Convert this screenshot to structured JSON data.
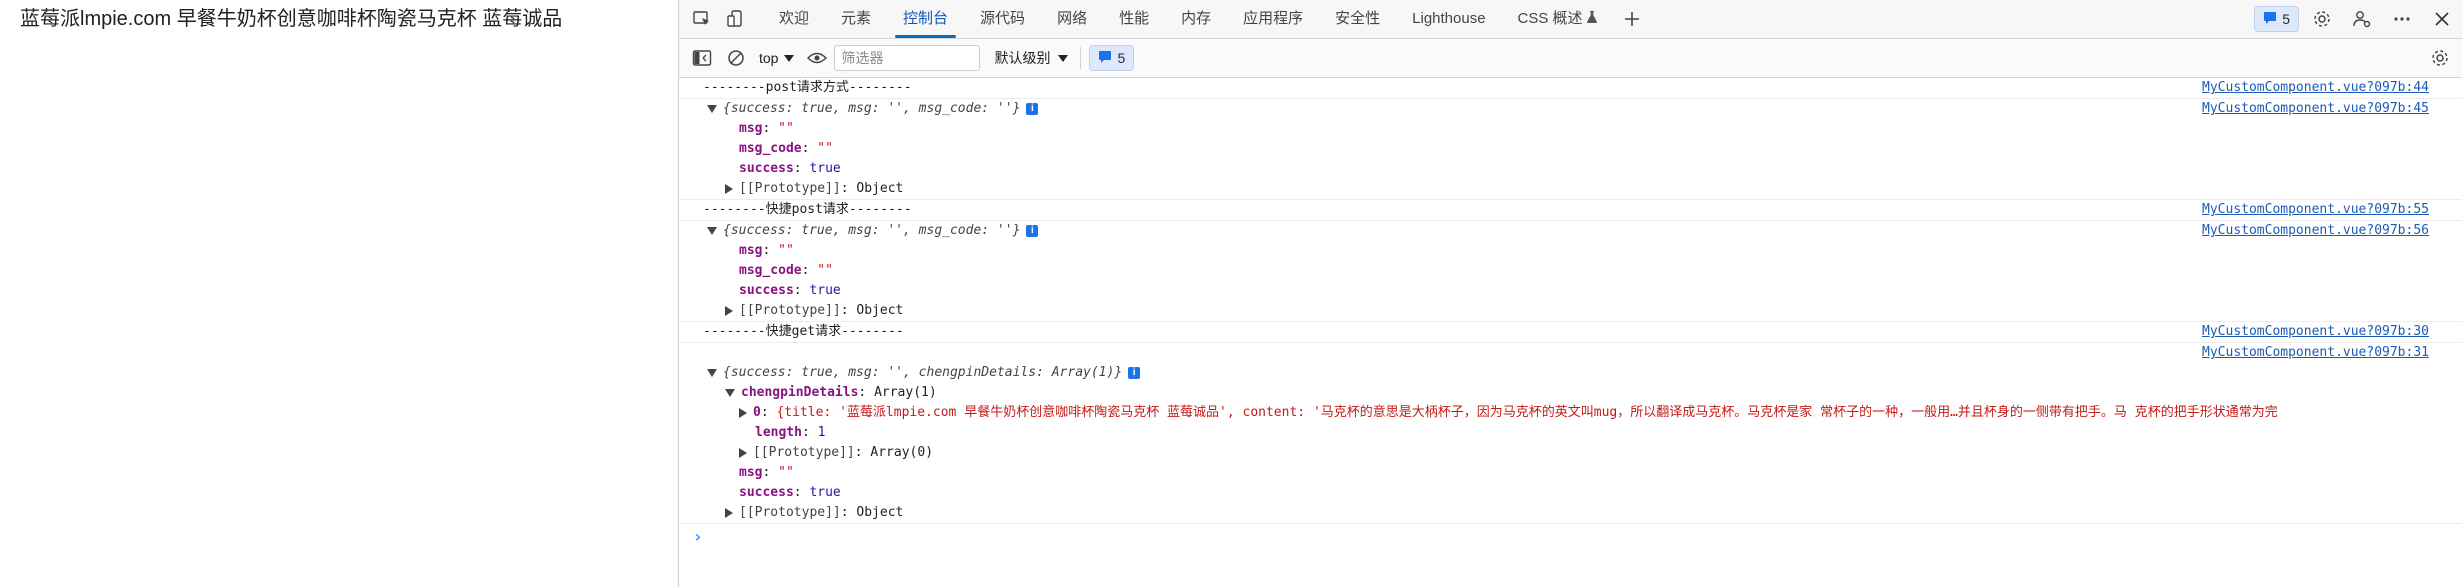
{
  "page": {
    "title": "蓝莓派lmpie.com 早餐牛奶杯创意咖啡杯陶瓷马克杯 蓝莓诚品"
  },
  "devtools": {
    "tabs": [
      {
        "label": "欢迎"
      },
      {
        "label": "元素"
      },
      {
        "label": "控制台"
      },
      {
        "label": "源代码"
      },
      {
        "label": "网络"
      },
      {
        "label": "性能"
      },
      {
        "label": "内存"
      },
      {
        "label": "应用程序"
      },
      {
        "label": "安全性"
      },
      {
        "label": "Lighthouse"
      },
      {
        "label": "CSS 概述"
      }
    ],
    "active_tab": "控制台",
    "issues_count": "5",
    "toolbar": {
      "context": "top",
      "filter_placeholder": "筛选器",
      "levels": "默认级别",
      "issues_count": "5"
    },
    "colors": {
      "accent": "#0f6cbd",
      "link": "#1a5bb8",
      "key": "#881280",
      "string": "#c41a16",
      "boolean": "#1a1aa6"
    }
  },
  "console": {
    "l1": {
      "text": "--------post请求方式--------",
      "src": "MyCustomComponent.vue?097b:44"
    },
    "l2": {
      "obj": "{success: true, msg: '', msg_code: ''}",
      "src": "MyCustomComponent.vue?097b:45"
    },
    "l3": {
      "key": "msg",
      "val": "\"\""
    },
    "l4": {
      "key": "msg_code",
      "val": "\"\""
    },
    "l5": {
      "key": "success",
      "val": "true"
    },
    "l6": {
      "key": "[[Prototype]]",
      "val": "Object"
    },
    "l7": {
      "text": "--------快捷post请求--------",
      "src": "MyCustomComponent.vue?097b:55"
    },
    "l8": {
      "obj": "{success: true, msg: '', msg_code: ''}",
      "src": "MyCustomComponent.vue?097b:56"
    },
    "l9": {
      "key": "msg",
      "val": "\"\""
    },
    "l10": {
      "key": "msg_code",
      "val": "\"\""
    },
    "l11": {
      "key": "success",
      "val": "true"
    },
    "l12": {
      "key": "[[Prototype]]",
      "val": "Object"
    },
    "l13": {
      "text": "--------快捷get请求--------",
      "src": "MyCustomComponent.vue?097b:30"
    },
    "l14": {
      "src": "MyCustomComponent.vue?097b:31"
    },
    "l15": {
      "obj": "{success: true, msg: '', chengpinDetails: Array(1)}"
    },
    "l16": {
      "key": "chengpinDetails",
      "val": "Array(1)"
    },
    "l17": {
      "key": "0",
      "val": "{title: '蓝莓派lmpie.com 早餐牛奶杯创意咖啡杯陶瓷马克杯 蓝莓诚品', content: '马克杯的意思是大柄杯子，因为马克杯的英文叫mug，所以翻译成马克杯。马克杯是家 常杯子的一种，一般用…并且杯身的一侧带有把手。马 克杯的把手形状通常为完"
    },
    "l18": {
      "key": "length",
      "val": "1"
    },
    "l19": {
      "key": "[[Prototype]]",
      "val": "Array(0)"
    },
    "l20": {
      "key": "msg",
      "val": "\"\""
    },
    "l21": {
      "key": "success",
      "val": "true"
    },
    "l22": {
      "key": "[[Prototype]]",
      "val": "Object"
    },
    "prompt": "›"
  }
}
